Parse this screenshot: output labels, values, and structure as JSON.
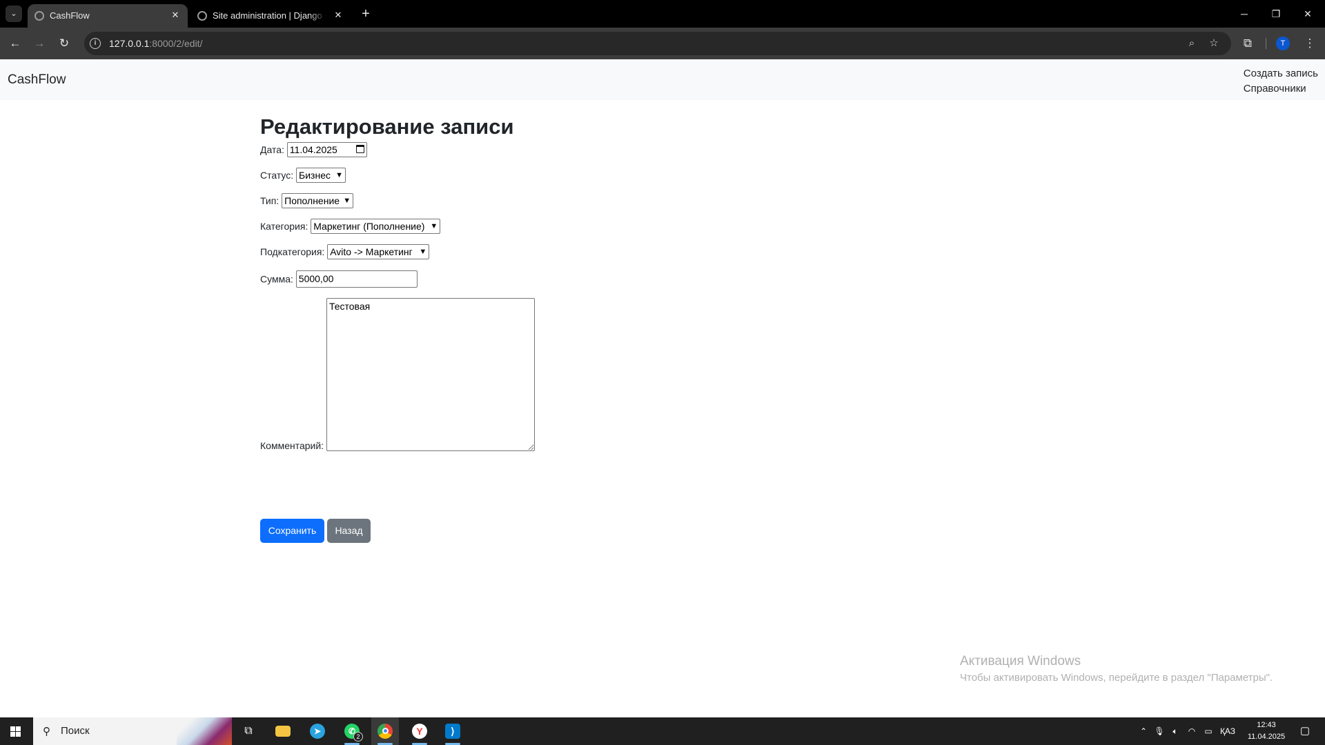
{
  "browser": {
    "tabs": [
      {
        "title": "CashFlow",
        "active": true
      },
      {
        "title": "Site administration | Django site admin",
        "active": false
      }
    ],
    "url_host": "127.0.0.1",
    "url_rest": ":8000/2/edit/",
    "profile_initial": "T"
  },
  "navbar": {
    "brand": "CashFlow",
    "links": [
      "Создать запись",
      "Справочники"
    ]
  },
  "form": {
    "title": "Редактирование записи",
    "date_label": "Дата:",
    "date_value": "11.04.2025",
    "status_label": "Статус:",
    "status_value": "Бизнес",
    "type_label": "Тип:",
    "type_value": "Пополнение",
    "category_label": "Категория:",
    "category_value": "Маркетинг (Пополнение)",
    "subcategory_label": "Подкатегория:",
    "subcategory_value": "Avito -> Маркетинг",
    "amount_label": "Сумма:",
    "amount_value": "5000,00",
    "comment_label": "Комментарий:",
    "comment_value": "Тестовая",
    "save_label": "Сохранить",
    "back_label": "Назад"
  },
  "watermark": {
    "line1": "Активация Windows",
    "line2": "Чтобы активировать Windows, перейдите в раздел \"Параметры\"."
  },
  "taskbar": {
    "search_placeholder": "Поиск",
    "whatsapp_badge": "2",
    "language": "ҚАЗ",
    "time": "12:43",
    "date": "11.04.2025"
  },
  "colors": {
    "primary": "#0d6efd",
    "secondary": "#6c757d",
    "navbar_bg": "#f8f9fa"
  }
}
